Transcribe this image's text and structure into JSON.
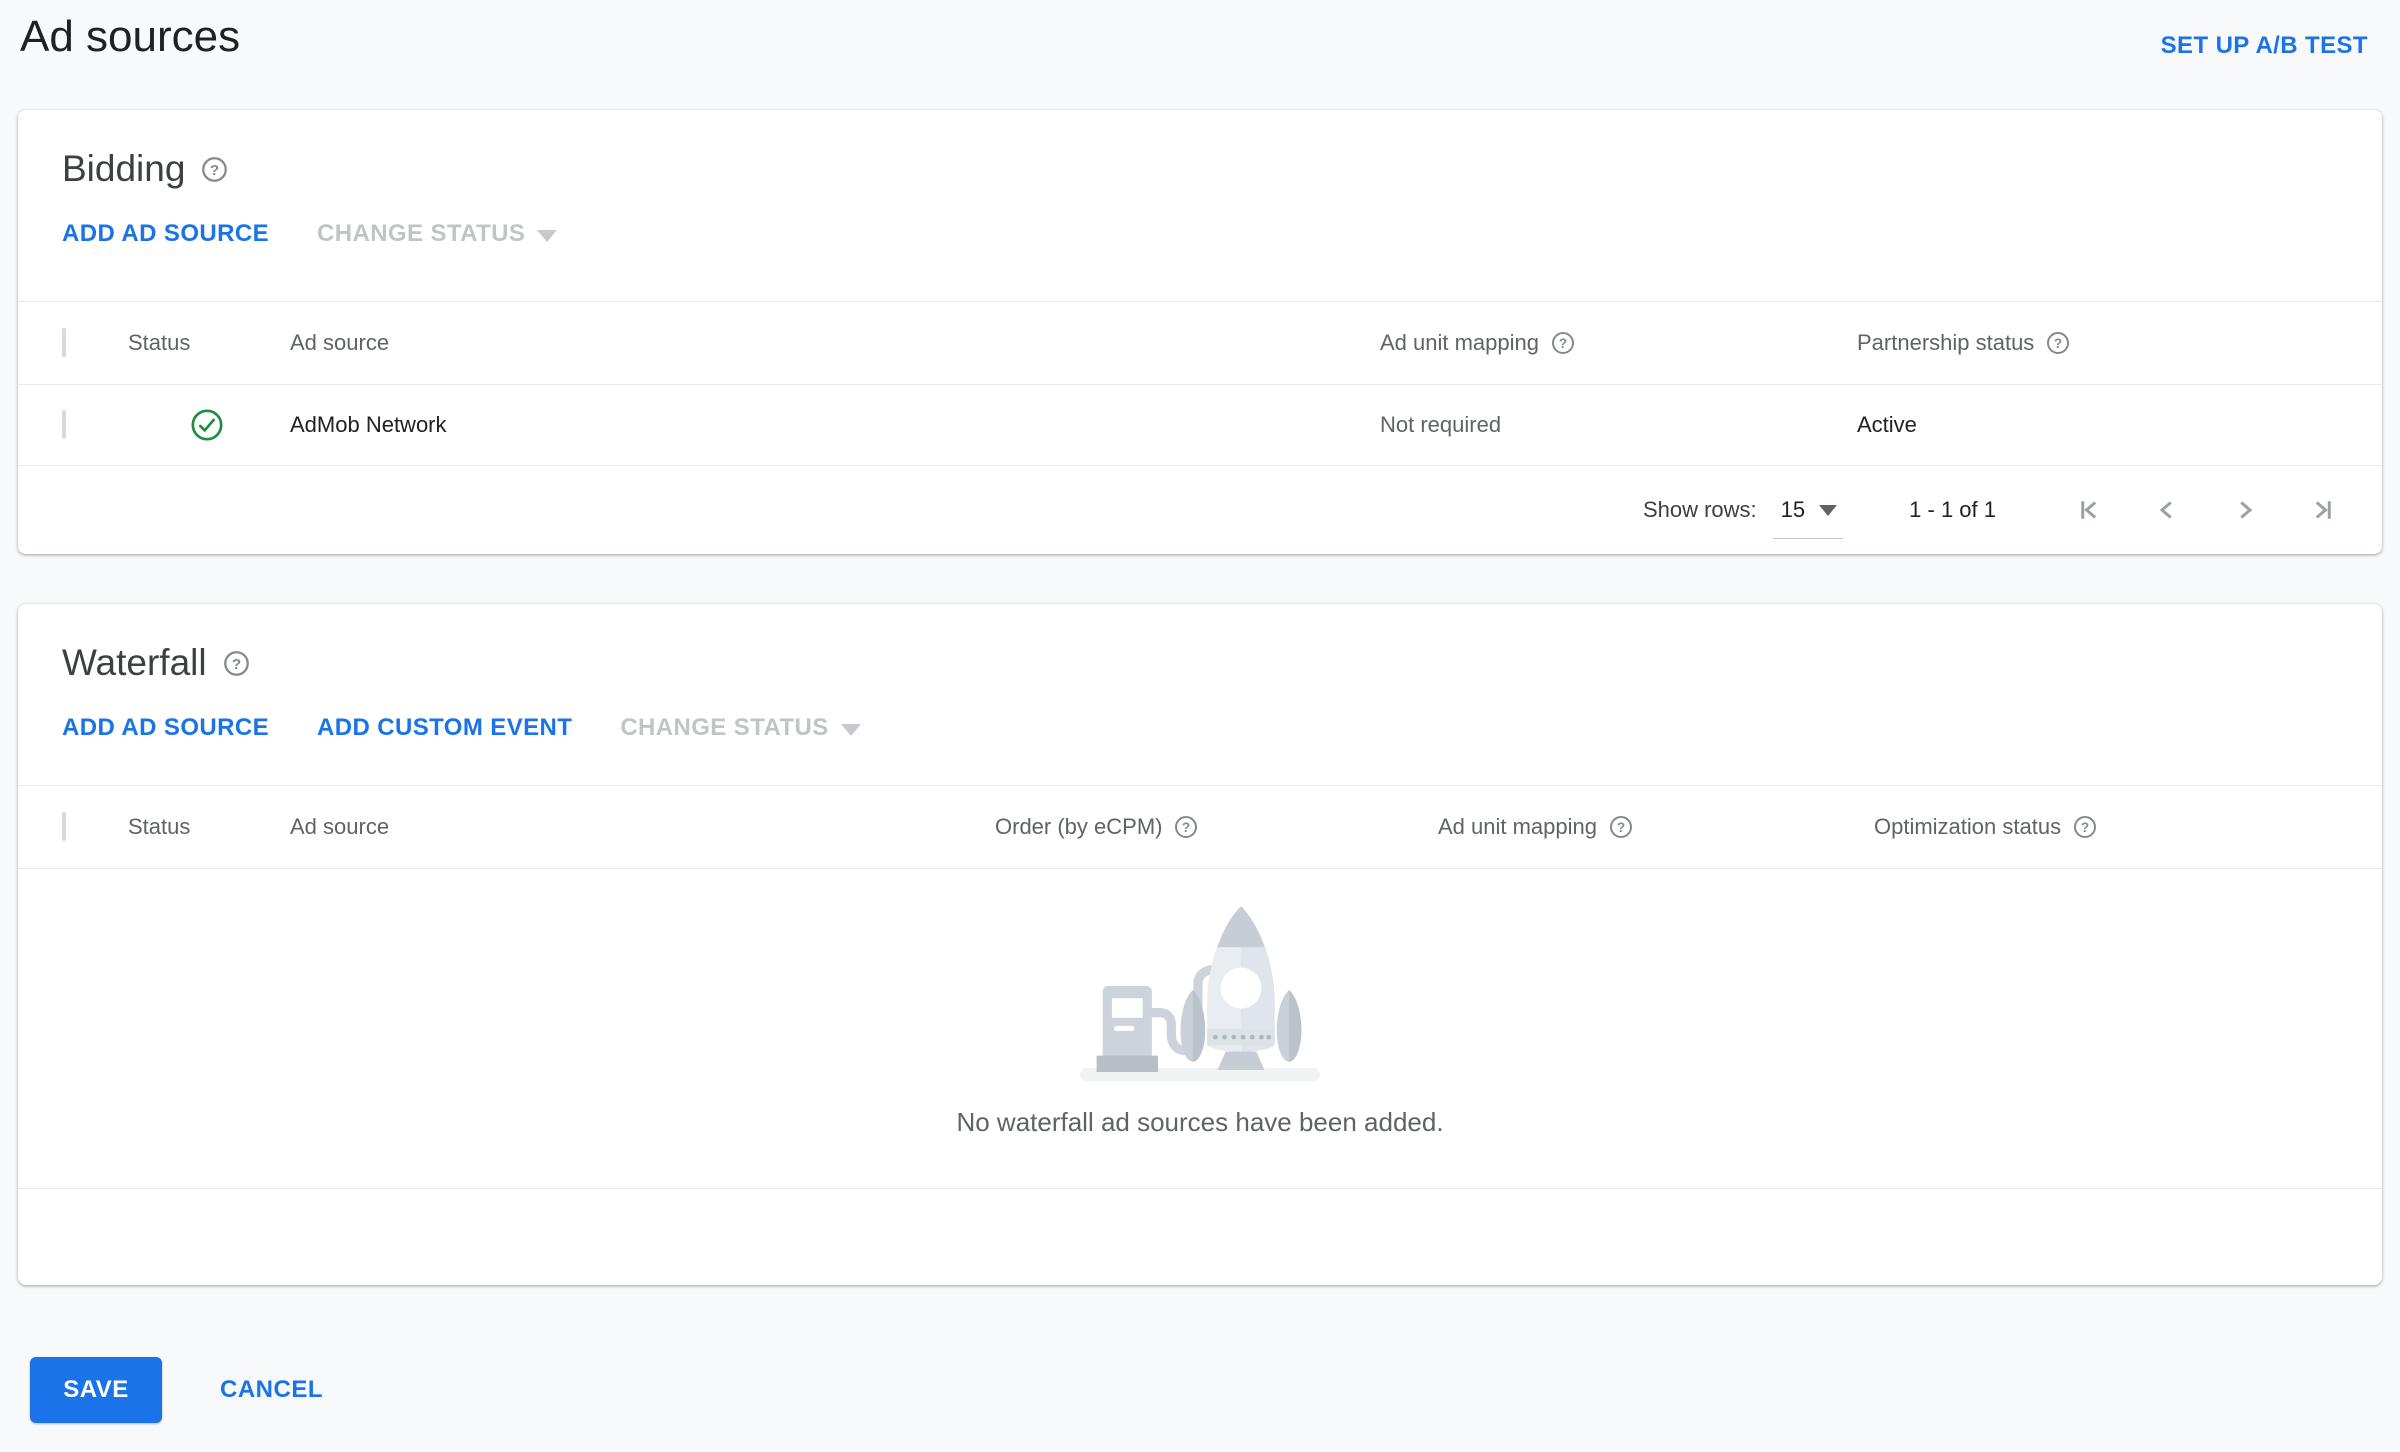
{
  "page": {
    "title": "Ad sources",
    "ab_test_label": "SET UP A/B TEST"
  },
  "bidding": {
    "title": "Bidding",
    "actions": {
      "add_ad_source": "ADD AD SOURCE",
      "change_status": "CHANGE STATUS"
    },
    "table": {
      "headers": {
        "status": "Status",
        "ad_source": "Ad source",
        "ad_unit_mapping": "Ad unit mapping",
        "partnership_status": "Partnership status"
      },
      "rows": [
        {
          "status_icon": "check-circle-icon",
          "ad_source": "AdMob Network",
          "ad_unit_mapping": "Not required",
          "partnership_status": "Active"
        }
      ]
    },
    "pagination": {
      "show_rows_label": "Show rows:",
      "rows_per_page": "15",
      "range": "1 - 1 of 1",
      "nav_icons": [
        "first-page-icon",
        "previous-page-icon",
        "next-page-icon",
        "last-page-icon"
      ]
    }
  },
  "waterfall": {
    "title": "Waterfall",
    "actions": {
      "add_ad_source": "ADD AD SOURCE",
      "add_custom_event": "ADD CUSTOM EVENT",
      "change_status": "CHANGE STATUS"
    },
    "table": {
      "headers": {
        "status": "Status",
        "ad_source": "Ad source",
        "order": "Order (by eCPM)",
        "ad_unit_mapping": "Ad unit mapping",
        "optimization_status": "Optimization status"
      }
    },
    "empty_state": {
      "illustration": "rocket-fuel-pump-illustration",
      "message": "No waterfall ad sources have been added."
    }
  },
  "footer": {
    "save": "SAVE",
    "cancel": "CANCEL"
  },
  "icons": {
    "help": "help-icon",
    "row_status": "check-circle-icon",
    "dropdown": "caret-down-icon"
  },
  "colors": {
    "accent_blue": "#1a73e8",
    "disabled_text": "#c0c4c9",
    "success_green": "#1e8e3e",
    "text_primary": "#202124",
    "text_secondary": "#5f6368",
    "page_background": "#f8f9fa"
  }
}
